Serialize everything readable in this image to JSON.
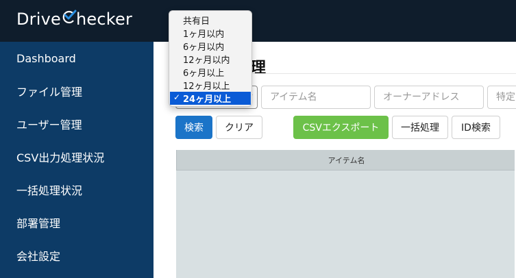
{
  "app": {
    "logo_prefix": "Drive",
    "logo_suffix": "hecker"
  },
  "sidebar": {
    "items": [
      {
        "label": "Dashboard"
      },
      {
        "label": "ファイル管理"
      },
      {
        "label": "ユーザー管理"
      },
      {
        "label": "CSV出力処理状況"
      },
      {
        "label": "一括処理状況"
      },
      {
        "label": "部署管理"
      },
      {
        "label": "会社設定"
      }
    ]
  },
  "page": {
    "title_visible": "理"
  },
  "filters": {
    "item_name_placeholder": "アイテム名",
    "owner_address_placeholder": "オーナーアドレス",
    "specific_placeholder": "特定"
  },
  "buttons": {
    "search": "検索",
    "clear": "クリア",
    "csv_export": "CSVエクスポート",
    "bulk": "一括処理",
    "id_search": "ID検索"
  },
  "table": {
    "header": "アイテム名"
  },
  "dropdown": {
    "options": [
      {
        "label": "共有日"
      },
      {
        "label": "1ヶ月以内"
      },
      {
        "label": "6ヶ月以内"
      },
      {
        "label": "12ヶ月以内"
      },
      {
        "label": "6ヶ月以上"
      },
      {
        "label": "12ヶ月以上"
      },
      {
        "label": "24ヶ月以上"
      }
    ],
    "selected_index": 6,
    "check_mark": "✓"
  },
  "colors": {
    "topbar": "#0f1d2c",
    "sidebar": "#0d3b66",
    "primary": "#1b74c8",
    "green": "#6cc149",
    "selection": "#0a5bd6",
    "logo_check": "#2a8fe0"
  }
}
